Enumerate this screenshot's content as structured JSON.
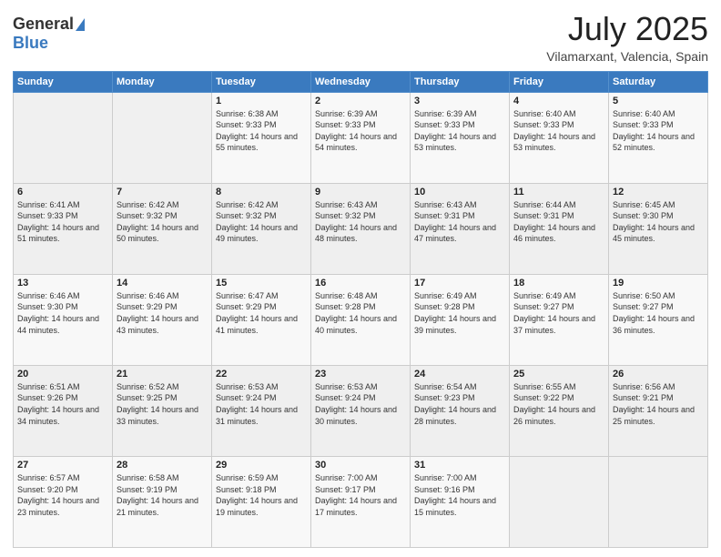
{
  "logo": {
    "general": "General",
    "blue": "Blue"
  },
  "title": "July 2025",
  "location": "Vilamarxant, Valencia, Spain",
  "days_of_week": [
    "Sunday",
    "Monday",
    "Tuesday",
    "Wednesday",
    "Thursday",
    "Friday",
    "Saturday"
  ],
  "weeks": [
    [
      {
        "day": "",
        "info": ""
      },
      {
        "day": "",
        "info": ""
      },
      {
        "day": "1",
        "sunrise": "Sunrise: 6:38 AM",
        "sunset": "Sunset: 9:33 PM",
        "daylight": "Daylight: 14 hours and 55 minutes."
      },
      {
        "day": "2",
        "sunrise": "Sunrise: 6:39 AM",
        "sunset": "Sunset: 9:33 PM",
        "daylight": "Daylight: 14 hours and 54 minutes."
      },
      {
        "day": "3",
        "sunrise": "Sunrise: 6:39 AM",
        "sunset": "Sunset: 9:33 PM",
        "daylight": "Daylight: 14 hours and 53 minutes."
      },
      {
        "day": "4",
        "sunrise": "Sunrise: 6:40 AM",
        "sunset": "Sunset: 9:33 PM",
        "daylight": "Daylight: 14 hours and 53 minutes."
      },
      {
        "day": "5",
        "sunrise": "Sunrise: 6:40 AM",
        "sunset": "Sunset: 9:33 PM",
        "daylight": "Daylight: 14 hours and 52 minutes."
      }
    ],
    [
      {
        "day": "6",
        "sunrise": "Sunrise: 6:41 AM",
        "sunset": "Sunset: 9:33 PM",
        "daylight": "Daylight: 14 hours and 51 minutes."
      },
      {
        "day": "7",
        "sunrise": "Sunrise: 6:42 AM",
        "sunset": "Sunset: 9:32 PM",
        "daylight": "Daylight: 14 hours and 50 minutes."
      },
      {
        "day": "8",
        "sunrise": "Sunrise: 6:42 AM",
        "sunset": "Sunset: 9:32 PM",
        "daylight": "Daylight: 14 hours and 49 minutes."
      },
      {
        "day": "9",
        "sunrise": "Sunrise: 6:43 AM",
        "sunset": "Sunset: 9:32 PM",
        "daylight": "Daylight: 14 hours and 48 minutes."
      },
      {
        "day": "10",
        "sunrise": "Sunrise: 6:43 AM",
        "sunset": "Sunset: 9:31 PM",
        "daylight": "Daylight: 14 hours and 47 minutes."
      },
      {
        "day": "11",
        "sunrise": "Sunrise: 6:44 AM",
        "sunset": "Sunset: 9:31 PM",
        "daylight": "Daylight: 14 hours and 46 minutes."
      },
      {
        "day": "12",
        "sunrise": "Sunrise: 6:45 AM",
        "sunset": "Sunset: 9:30 PM",
        "daylight": "Daylight: 14 hours and 45 minutes."
      }
    ],
    [
      {
        "day": "13",
        "sunrise": "Sunrise: 6:46 AM",
        "sunset": "Sunset: 9:30 PM",
        "daylight": "Daylight: 14 hours and 44 minutes."
      },
      {
        "day": "14",
        "sunrise": "Sunrise: 6:46 AM",
        "sunset": "Sunset: 9:29 PM",
        "daylight": "Daylight: 14 hours and 43 minutes."
      },
      {
        "day": "15",
        "sunrise": "Sunrise: 6:47 AM",
        "sunset": "Sunset: 9:29 PM",
        "daylight": "Daylight: 14 hours and 41 minutes."
      },
      {
        "day": "16",
        "sunrise": "Sunrise: 6:48 AM",
        "sunset": "Sunset: 9:28 PM",
        "daylight": "Daylight: 14 hours and 40 minutes."
      },
      {
        "day": "17",
        "sunrise": "Sunrise: 6:49 AM",
        "sunset": "Sunset: 9:28 PM",
        "daylight": "Daylight: 14 hours and 39 minutes."
      },
      {
        "day": "18",
        "sunrise": "Sunrise: 6:49 AM",
        "sunset": "Sunset: 9:27 PM",
        "daylight": "Daylight: 14 hours and 37 minutes."
      },
      {
        "day": "19",
        "sunrise": "Sunrise: 6:50 AM",
        "sunset": "Sunset: 9:27 PM",
        "daylight": "Daylight: 14 hours and 36 minutes."
      }
    ],
    [
      {
        "day": "20",
        "sunrise": "Sunrise: 6:51 AM",
        "sunset": "Sunset: 9:26 PM",
        "daylight": "Daylight: 14 hours and 34 minutes."
      },
      {
        "day": "21",
        "sunrise": "Sunrise: 6:52 AM",
        "sunset": "Sunset: 9:25 PM",
        "daylight": "Daylight: 14 hours and 33 minutes."
      },
      {
        "day": "22",
        "sunrise": "Sunrise: 6:53 AM",
        "sunset": "Sunset: 9:24 PM",
        "daylight": "Daylight: 14 hours and 31 minutes."
      },
      {
        "day": "23",
        "sunrise": "Sunrise: 6:53 AM",
        "sunset": "Sunset: 9:24 PM",
        "daylight": "Daylight: 14 hours and 30 minutes."
      },
      {
        "day": "24",
        "sunrise": "Sunrise: 6:54 AM",
        "sunset": "Sunset: 9:23 PM",
        "daylight": "Daylight: 14 hours and 28 minutes."
      },
      {
        "day": "25",
        "sunrise": "Sunrise: 6:55 AM",
        "sunset": "Sunset: 9:22 PM",
        "daylight": "Daylight: 14 hours and 26 minutes."
      },
      {
        "day": "26",
        "sunrise": "Sunrise: 6:56 AM",
        "sunset": "Sunset: 9:21 PM",
        "daylight": "Daylight: 14 hours and 25 minutes."
      }
    ],
    [
      {
        "day": "27",
        "sunrise": "Sunrise: 6:57 AM",
        "sunset": "Sunset: 9:20 PM",
        "daylight": "Daylight: 14 hours and 23 minutes."
      },
      {
        "day": "28",
        "sunrise": "Sunrise: 6:58 AM",
        "sunset": "Sunset: 9:19 PM",
        "daylight": "Daylight: 14 hours and 21 minutes."
      },
      {
        "day": "29",
        "sunrise": "Sunrise: 6:59 AM",
        "sunset": "Sunset: 9:18 PM",
        "daylight": "Daylight: 14 hours and 19 minutes."
      },
      {
        "day": "30",
        "sunrise": "Sunrise: 7:00 AM",
        "sunset": "Sunset: 9:17 PM",
        "daylight": "Daylight: 14 hours and 17 minutes."
      },
      {
        "day": "31",
        "sunrise": "Sunrise: 7:00 AM",
        "sunset": "Sunset: 9:16 PM",
        "daylight": "Daylight: 14 hours and 15 minutes."
      },
      {
        "day": "",
        "info": ""
      },
      {
        "day": "",
        "info": ""
      }
    ]
  ]
}
